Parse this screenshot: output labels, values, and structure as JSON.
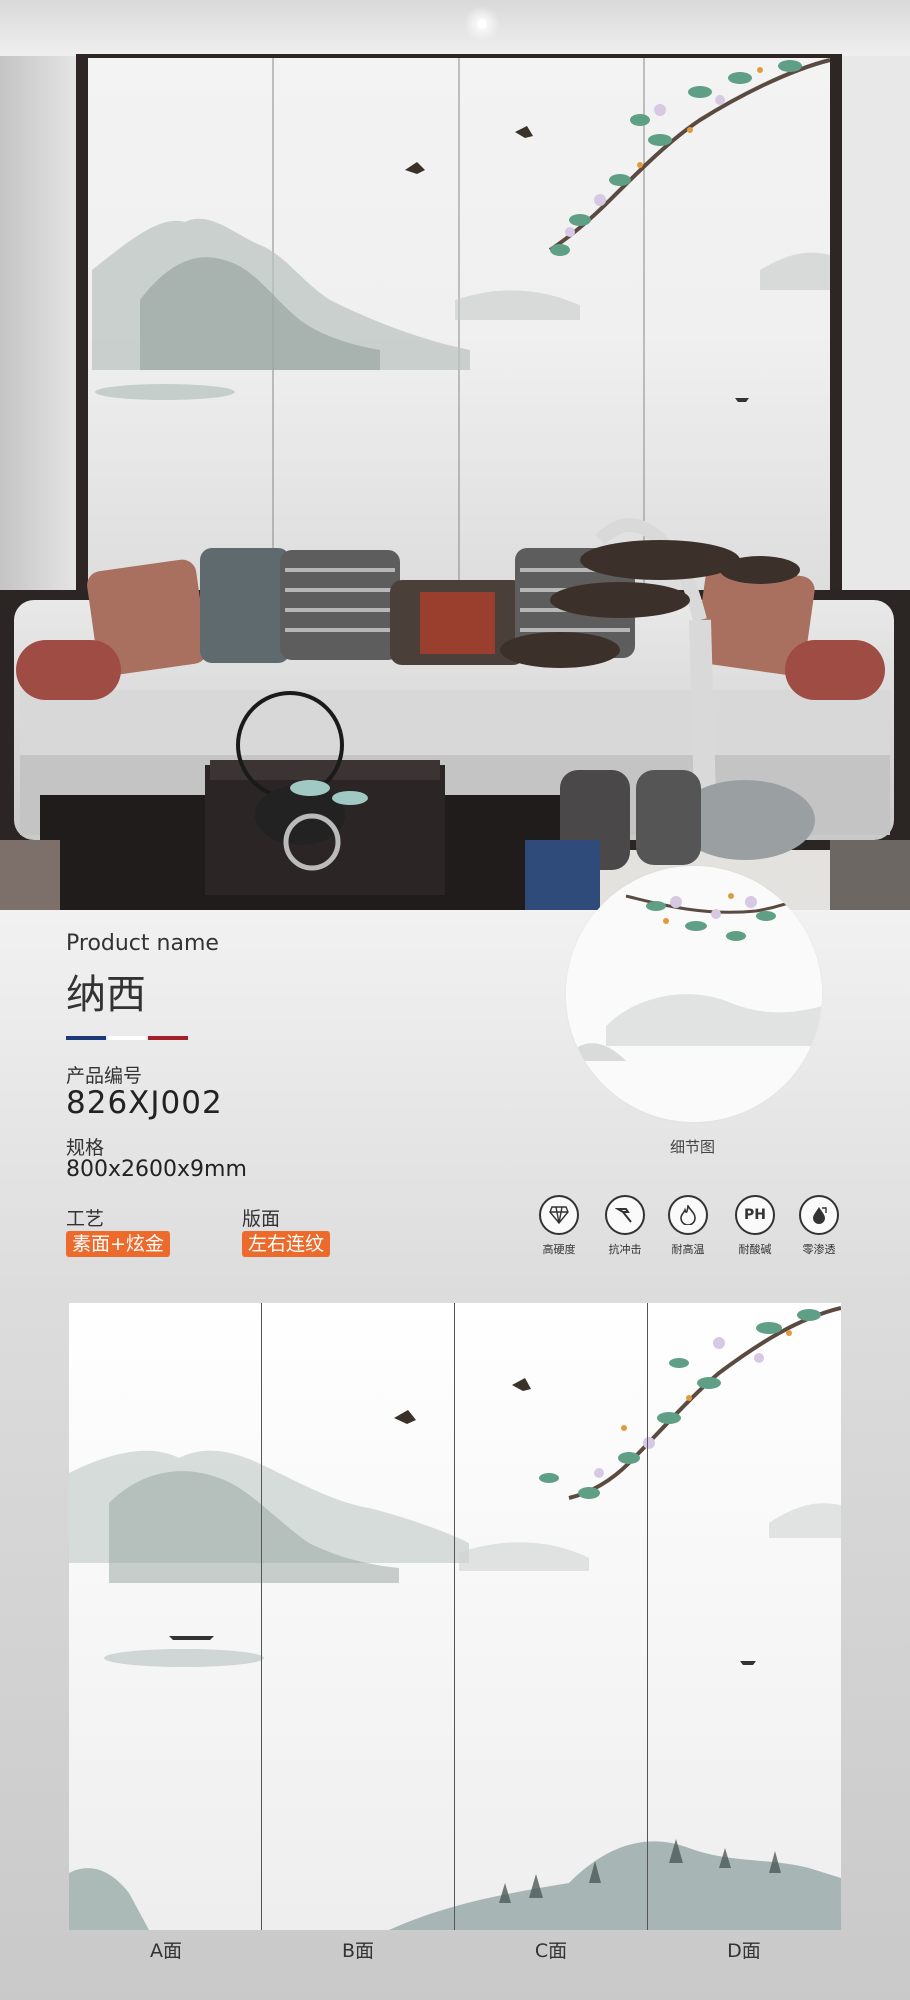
{
  "product": {
    "name_label": "Product name",
    "name": "纳西",
    "code_label": "产品编号",
    "code": "826XJ002",
    "spec_label": "规格",
    "spec": "800x2600x9mm",
    "craft_label": "工艺",
    "craft": "素面+炫金",
    "layout_label": "版面",
    "layout": "左右连纹"
  },
  "detail": {
    "caption": "细节图"
  },
  "features": [
    {
      "icon": "diamond-icon",
      "label": "高硬度"
    },
    {
      "icon": "hammer-icon",
      "label": "抗冲击"
    },
    {
      "icon": "flame-icon",
      "label": "耐高温"
    },
    {
      "icon": "ph-icon",
      "text": "PH",
      "label": "耐酸碱"
    },
    {
      "icon": "water-drop-icon",
      "label": "零渗透"
    }
  ],
  "faces": [
    "A面",
    "B面",
    "C面",
    "D面"
  ],
  "colors": {
    "accent_orange": "#ec6a2c",
    "stripe_blue": "#1d3a78",
    "stripe_red": "#a3202a"
  }
}
